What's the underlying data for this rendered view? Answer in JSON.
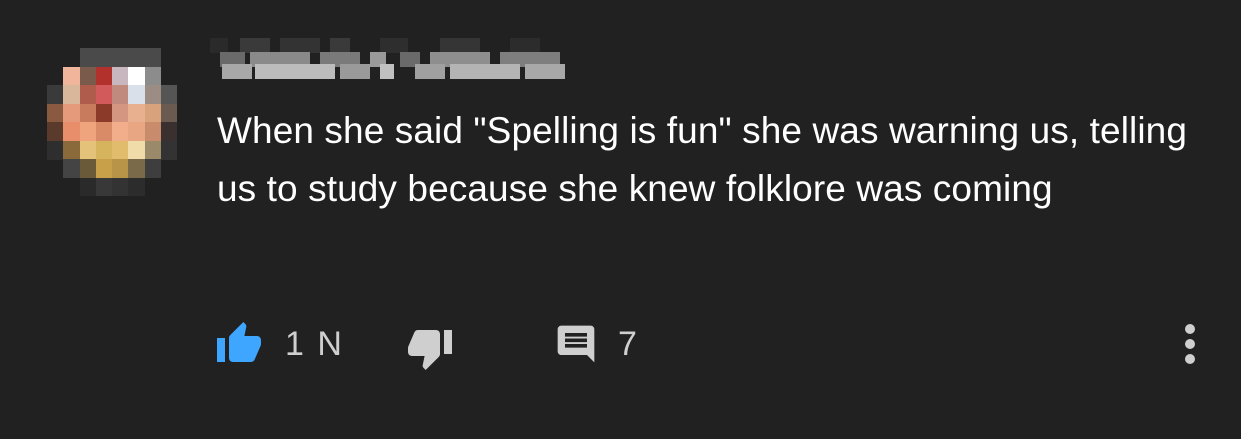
{
  "comment": {
    "text": "When she said \"Spelling is fun\" she was warning us, telling us to study because she knew folklore was coming",
    "author_name": ""
  },
  "actions": {
    "like_count": "1 N",
    "reply_count": "7"
  },
  "icons": {
    "like": "thumbs-up-icon",
    "dislike": "thumbs-down-icon",
    "reply": "comment-icon",
    "menu": "more-vertical-icon"
  },
  "colors": {
    "background": "#212121",
    "text": "#ffffff",
    "like_active": "#3ea6ff",
    "icon_muted": "#cfcfcf"
  }
}
